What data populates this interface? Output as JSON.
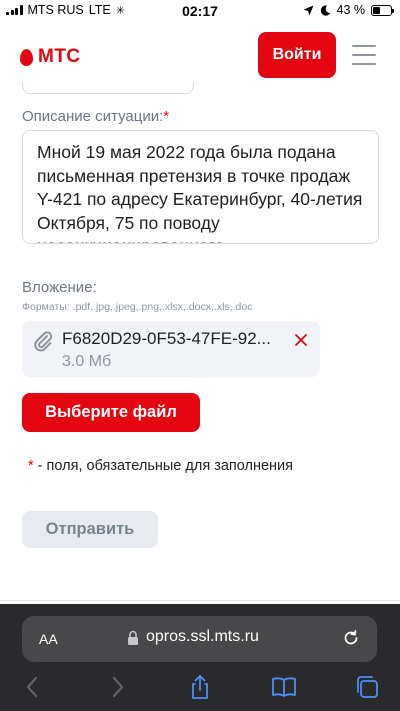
{
  "status_bar": {
    "carrier": "MTS RUS",
    "network": "LTE",
    "time": "02:17",
    "battery": "43 %",
    "battery_level": 0.43
  },
  "header": {
    "logo_text": "МТС",
    "login_label": "Войти",
    "brand_color": "#e30611"
  },
  "form": {
    "description_label": "Описание ситуации:",
    "required_mark": "*",
    "description_value": "Мной 19 мая 2022 года была подана письменная претензия в точке продаж Y-421 по адресу Екатеринбург, 40-летия Октября, 75 по поводу несанкционированного",
    "attachment_label": "Вложение:",
    "formats_text": "Форматы: .pdf,.jpg,.jpeg,.png,.xlsx,.docx,.xls,.doc",
    "file": {
      "name": "F6820D29-0F53-47FE-92...",
      "size": "3.0 Мб"
    },
    "choose_file_label": "Выберите файл",
    "required_note_star": "*",
    "required_note": " - поля, обязательные для заполнения",
    "submit_label": "Отправить"
  },
  "browser": {
    "text_size_label": "AA",
    "url": "opros.ssl.mts.ru"
  }
}
